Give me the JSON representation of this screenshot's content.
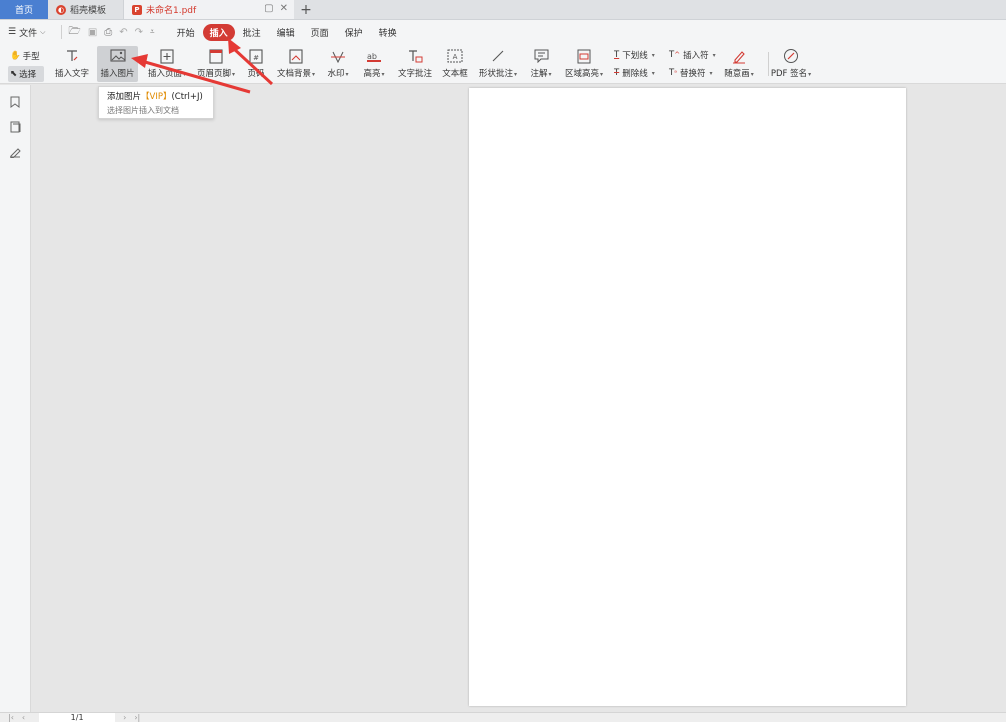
{
  "tabs": {
    "home": "首页",
    "template": "稻壳模板",
    "document": "未命名1.pdf"
  },
  "menu": {
    "file": "文件",
    "items": [
      "开始",
      "插入",
      "批注",
      "编辑",
      "页面",
      "保护",
      "转换"
    ],
    "active": "插入"
  },
  "ribbon": {
    "hand": "手型",
    "select": "选择",
    "insert_text": "插入文字",
    "insert_image": "插入图片",
    "insert_page": "插入页面",
    "header_footer": "页眉页脚",
    "page_number": "页码",
    "doc_background": "文档背景",
    "watermark": "水印",
    "highlight": "高亮",
    "text_annotation": "文字批注",
    "textbox": "文本框",
    "shape_annotation": "形状批注",
    "note": "注解",
    "area_highlight": "区域高亮",
    "underline": "下划线",
    "strikethrough": "删除线",
    "insert_symbol": "插入符",
    "replace_symbol": "替换符",
    "freehand": "随意画",
    "pdf_sign": "PDF 签名"
  },
  "tooltip": {
    "title": "添加图片",
    "vip": "【VIP】",
    "shortcut": "(Ctrl+J)",
    "desc": "选择图片插入到文档"
  },
  "status": {
    "page_display": "1/1"
  },
  "colors": {
    "accent": "#d33b34",
    "home_tab": "#4a7fd1"
  }
}
